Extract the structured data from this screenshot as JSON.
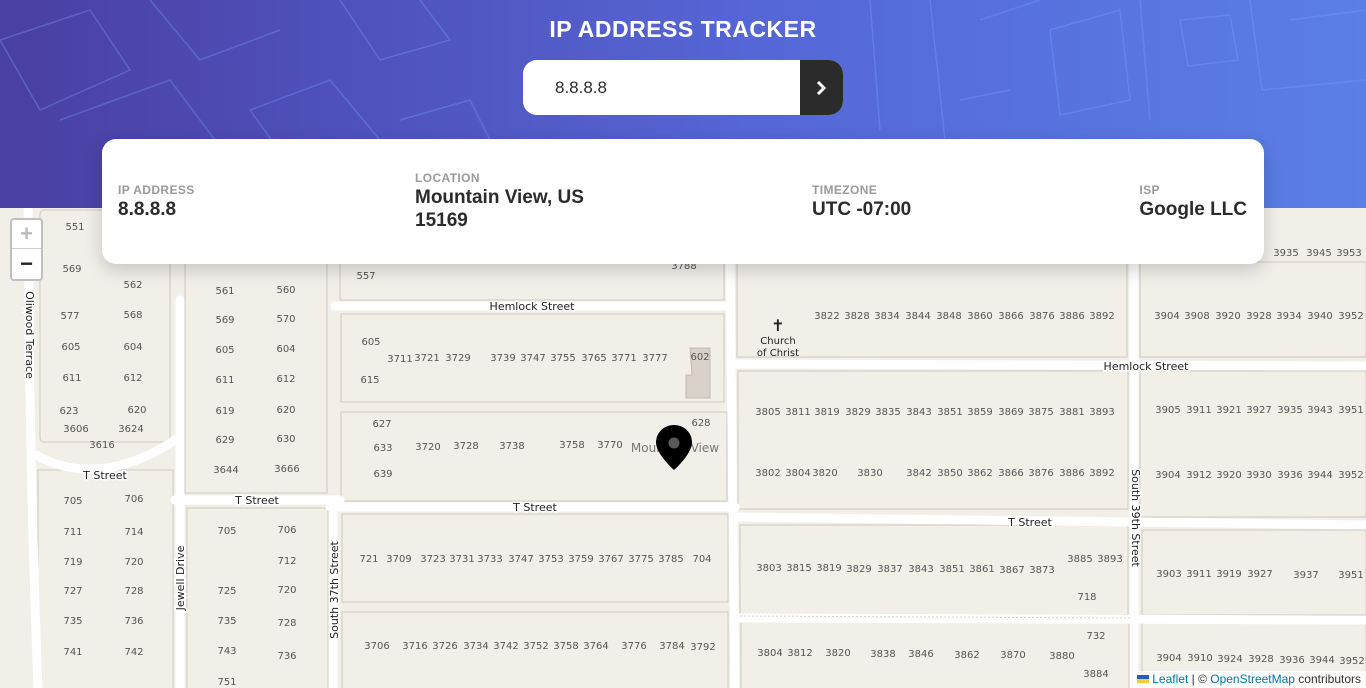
{
  "header": {
    "title": "IP ADDRESS TRACKER"
  },
  "search": {
    "value": "8.8.8.8",
    "button_icon": "chevron-right-icon"
  },
  "info": {
    "ip_label": "IP ADDRESS",
    "ip_value": "8.8.8.8",
    "location_label": "LOCATION",
    "location_value": "Mountain View, US 15169",
    "timezone_label": "TIMEZONE",
    "timezone_value": "UTC -07:00",
    "isp_label": "ISP",
    "isp_value": "Google LLC"
  },
  "map": {
    "zoom_in": "+",
    "zoom_out": "−",
    "marker_icon": "location-pin-icon",
    "attribution": {
      "leaflet": "Leaflet",
      "separator": " | © ",
      "osm": "OpenStreetMap",
      "suffix": " contributors"
    },
    "streets": [
      "Hemlock Street",
      "Hemlock Street",
      "T Street",
      "T Street",
      "T Street",
      "T Street",
      "Oliwood Terrace",
      "Jewell Drive",
      "South 37th Street",
      "South 39th Street"
    ],
    "poi": {
      "church_line1": "Church",
      "church_line2": "of Christ",
      "town": "Mountain View"
    }
  },
  "colors": {
    "header_start": "#4a3fa2",
    "header_end": "#5a7fe6",
    "button": "#2b2b2b"
  }
}
